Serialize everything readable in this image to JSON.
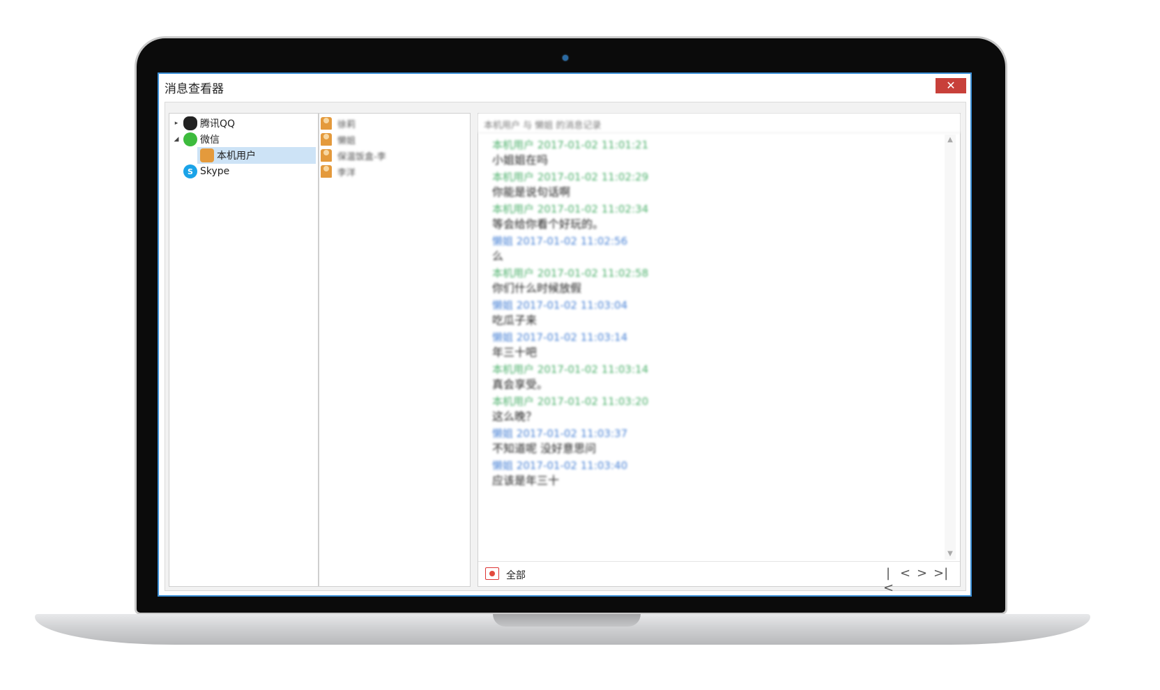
{
  "window": {
    "title": "消息查看器",
    "close_glyph": "✕"
  },
  "tree": [
    {
      "arrow": "▸",
      "icon": "qq-icon",
      "label": "腾讯QQ"
    },
    {
      "arrow": "◢",
      "icon": "wechat-icon",
      "label": "微信"
    },
    {
      "arrow": "",
      "icon": "user-icon",
      "label": "本机用户"
    },
    {
      "arrow": "",
      "icon": "skype-icon",
      "label": "Skype"
    }
  ],
  "contacts": [
    "徐莉",
    "懒姐",
    "保温饭盒-李",
    "李洋"
  ],
  "messages_header": "本机用户 与 懒姐 的消息记录",
  "messages": [
    {
      "sender": "本机用户",
      "time": "2017-01-02 11:01:21",
      "who": "me",
      "text": "小姐姐在吗"
    },
    {
      "sender": "本机用户",
      "time": "2017-01-02 11:02:29",
      "who": "me",
      "text": "你能是说句话啊"
    },
    {
      "sender": "本机用户",
      "time": "2017-01-02 11:02:34",
      "who": "me",
      "text": "等会给你看个好玩的。"
    },
    {
      "sender": "懒姐",
      "time": "2017-01-02 11:02:56",
      "who": "peer",
      "text": "么"
    },
    {
      "sender": "本机用户",
      "time": "2017-01-02 11:02:58",
      "who": "me",
      "text": "你们什么时候放假"
    },
    {
      "sender": "懒姐",
      "time": "2017-01-02 11:03:04",
      "who": "peer",
      "text": "吃瓜子来"
    },
    {
      "sender": "懒姐",
      "time": "2017-01-02 11:03:14",
      "who": "peer",
      "text": "年三十吧"
    },
    {
      "sender": "本机用户",
      "time": "2017-01-02 11:03:14",
      "who": "me",
      "text": "真会享受。"
    },
    {
      "sender": "本机用户",
      "time": "2017-01-02 11:03:20",
      "who": "me",
      "text": "这么晚？"
    },
    {
      "sender": "懒姐",
      "time": "2017-01-02 11:03:37",
      "who": "peer",
      "text": "不知道呢 没好意思问"
    },
    {
      "sender": "懒姐",
      "time": "2017-01-02 11:03:40",
      "who": "peer",
      "text": "应该是年三十"
    }
  ],
  "footer": {
    "filter_label": "全部",
    "pager": [
      "|<",
      "<",
      ">",
      ">|"
    ]
  },
  "colors": {
    "me": "#4cb06b",
    "peer": "#4a83d6",
    "accent": "#3b8fd6",
    "close": "#c8403a"
  }
}
